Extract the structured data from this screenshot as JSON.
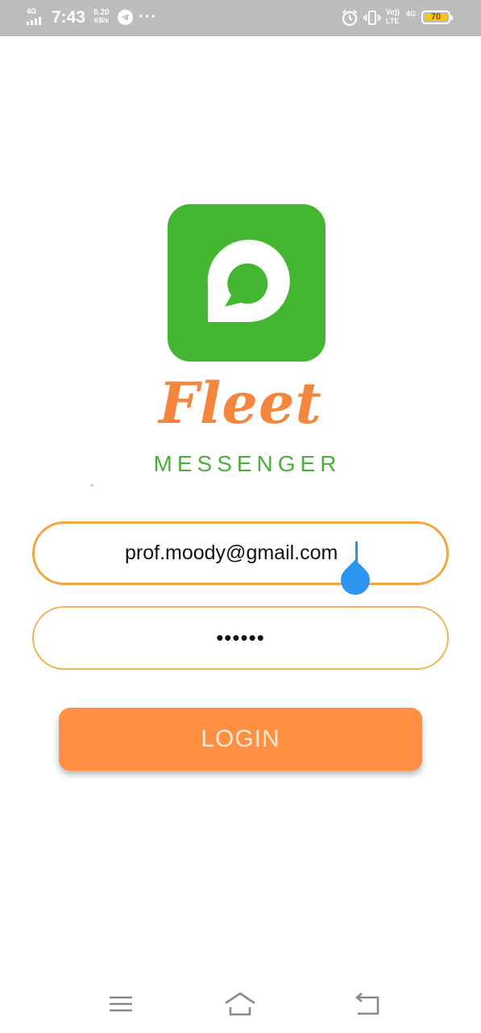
{
  "status_bar": {
    "network_label": "4G",
    "time": "7:43",
    "speed_value": "0.20",
    "speed_unit": "KB/s",
    "overflow": "···",
    "volte_top": "Vo))",
    "volte_bottom": "LTE",
    "network2_label": "4G",
    "battery_level": "70",
    "icons": [
      "signal-icon",
      "telegram-icon",
      "alarm-icon",
      "vibrate-icon",
      "battery-icon"
    ]
  },
  "brand": {
    "name": "Fleet",
    "subtitle": "MESSENGER",
    "logo_icon": "chat-bubble-icon",
    "colors": {
      "logo_bg": "#45b631",
      "name": "#f5863d",
      "subtitle": "#4caf3a"
    }
  },
  "login_form": {
    "email_value": "prof.moody@gmail.com",
    "password_mask": "••••••",
    "login_label": "LOGIN",
    "colors": {
      "field_border": "#f3a541",
      "button_bg": "#fe8f43",
      "caret": "#2b95ef"
    }
  },
  "nav_bar": {
    "icons": [
      "menu-icon",
      "home-icon",
      "back-icon"
    ]
  }
}
